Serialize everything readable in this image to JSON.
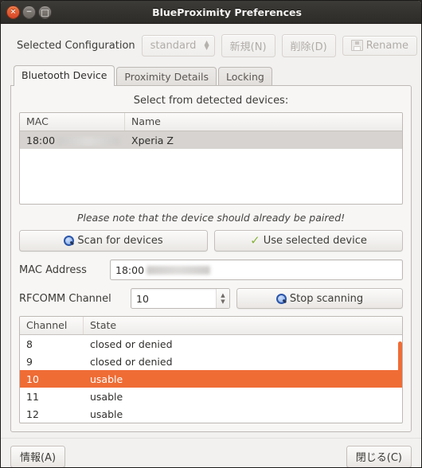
{
  "window": {
    "title": "BlueProximity Preferences",
    "controls": {
      "close": "×",
      "minimize": "−",
      "maximize": "□"
    }
  },
  "config": {
    "label": "Selected Configuration",
    "selected": "standard",
    "new_label": "新規(N)",
    "delete_label": "削除(D)",
    "rename_label": "Rename",
    "rename_icon": "save-icon"
  },
  "tabs": [
    {
      "label": "Bluetooth Device",
      "active": true
    },
    {
      "label": "Proximity Details",
      "active": false
    },
    {
      "label": "Locking",
      "active": false
    }
  ],
  "bluetooth_tab": {
    "heading": "Select from detected devices:",
    "device_table": {
      "columns": [
        "MAC",
        "Name"
      ],
      "rows": [
        {
          "mac_prefix": "18:00",
          "mac_redacted": true,
          "name": "Xperia Z",
          "selected": true
        }
      ]
    },
    "note": "Please note that the device should already be paired!",
    "scan_button": {
      "label": "Scan for devices",
      "icon": "magnifier-icon"
    },
    "use_button": {
      "label": "Use selected device",
      "icon": "check-icon"
    },
    "mac_field": {
      "label": "MAC Address",
      "value": "18:00",
      "redacted": true
    },
    "rfcomm_field": {
      "label": "RFCOMM Channel",
      "value": "10"
    },
    "stop_button": {
      "label": "Stop scanning",
      "icon": "magnifier-icon"
    },
    "channel_table": {
      "columns": [
        "Channel",
        "State"
      ],
      "rows": [
        {
          "channel": "8",
          "state": "closed or denied",
          "selected": false
        },
        {
          "channel": "9",
          "state": "closed or denied",
          "selected": false
        },
        {
          "channel": "10",
          "state": "usable",
          "selected": true
        },
        {
          "channel": "11",
          "state": "usable",
          "selected": false
        },
        {
          "channel": "12",
          "state": "usable",
          "selected": false
        }
      ]
    }
  },
  "footer": {
    "about_label": "情報(A)",
    "close_label": "閉じる(C)"
  },
  "colors": {
    "selection_orange": "#ef6c35",
    "row_selected_grey": "#d6d3d0",
    "titlebar": "#35332f",
    "window_bg": "#f2f1f0"
  }
}
